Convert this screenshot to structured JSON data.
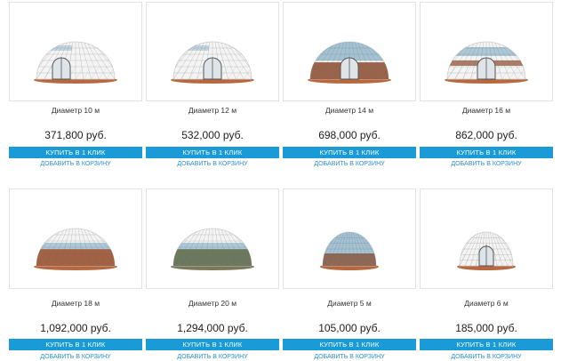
{
  "products": [
    {
      "title": "Диаметр 10 м",
      "price": "371,800 руб.",
      "buy_label": "КУПИТЬ В 1 КЛИК",
      "cart_label": "ДОБАВИТЬ В КОРЗИНУ",
      "dome_style": "door-left",
      "floor_color": "#b8683f"
    },
    {
      "title": "Диаметр 12 м",
      "price": "532,000 руб.",
      "buy_label": "КУПИТЬ В 1 КЛИК",
      "cart_label": "ДОБАВИТЬ В КОРЗИНУ",
      "dome_style": "door-center",
      "floor_color": "#b8683f"
    },
    {
      "title": "Диаметр 14 м",
      "price": "698,000 руб.",
      "buy_label": "КУПИТЬ В 1 КЛИК",
      "cart_label": "ДОБАВИТЬ В КОРЗИНУ",
      "dome_style": "glass-top",
      "floor_color": "#b8683f"
    },
    {
      "title": "Диаметр 16 м",
      "price": "862,000 руб.",
      "buy_label": "КУПИТЬ В 1 КЛИК",
      "cart_label": "ДОБАВИТЬ В КОРЗИНУ",
      "dome_style": "glass-band",
      "floor_color": "#b8683f"
    },
    {
      "title": "Диаметр 18 м",
      "price": "1,092,000 руб.",
      "buy_label": "КУПИТЬ В 1 КЛИК",
      "cart_label": "ДОБАВИТЬ В КОРЗИНУ",
      "dome_style": "glass-bottom",
      "floor_color": "#b8683f"
    },
    {
      "title": "Диаметр 20 м",
      "price": "1,294,000 руб.",
      "buy_label": "КУПИТЬ В 1 КЛИК",
      "cart_label": "ДОБАВИТЬ В КОРЗИНУ",
      "dome_style": "glass-bottom-green",
      "floor_color": "#7a7a5a"
    },
    {
      "title": "Диаметр 5 м",
      "price": "105,000 руб.",
      "buy_label": "КУПИТЬ В 1 КЛИК",
      "cart_label": "ДОБАВИТЬ В КОРЗИНУ",
      "dome_style": "glass-full",
      "floor_color": "#b8683f"
    },
    {
      "title": "Диаметр 6 м",
      "price": "185,000 руб.",
      "buy_label": "КУПИТЬ В 1 КЛИК",
      "cart_label": "ДОБАВИТЬ В КОРЗИНУ",
      "dome_style": "small-door",
      "floor_color": "#b8683f"
    }
  ],
  "colors": {
    "accent": "#1a9ad6",
    "link": "#2a8fd0",
    "dome_white": "#f4f4f4",
    "glass": "#8fb6cc",
    "frame": "#6e6a66"
  }
}
